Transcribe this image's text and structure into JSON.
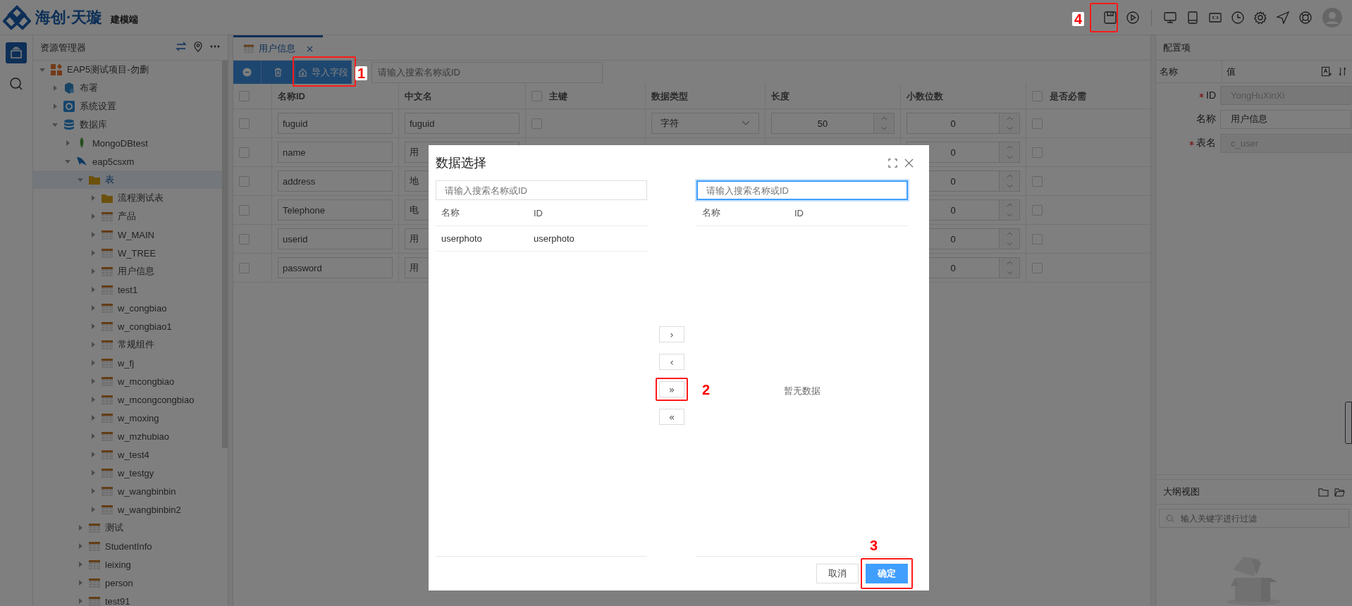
{
  "header": {
    "brand": "海创·天璇",
    "subtitle": "建模端",
    "tools_left": [
      {
        "kind": "save",
        "callout": "4"
      },
      {
        "kind": "play"
      }
    ],
    "tools_right": [
      {
        "kind": "desktop"
      },
      {
        "kind": "tablet"
      },
      {
        "kind": "ratio"
      },
      {
        "kind": "clock"
      },
      {
        "kind": "settings"
      },
      {
        "kind": "send"
      },
      {
        "kind": "help"
      },
      {
        "kind": "avatar"
      }
    ]
  },
  "activity_bar": [
    {
      "kind": "explorer",
      "selected": true
    },
    {
      "kind": "search",
      "selected": false
    }
  ],
  "explorer": {
    "title": "资源管理器",
    "actions": [
      {
        "kind": "swap"
      },
      {
        "kind": "locate"
      },
      {
        "kind": "more"
      }
    ],
    "tree": [
      {
        "kind": "project",
        "label": "EAP5测试项目-勿删",
        "expanded": true,
        "selected": false,
        "children": [
          {
            "kind": "deploy",
            "label": "布署",
            "expanded": false,
            "selected": false
          },
          {
            "kind": "settings",
            "label": "系统设置",
            "expanded": false,
            "selected": false
          },
          {
            "kind": "database",
            "label": "数据库",
            "expanded": true,
            "selected": false,
            "children": [
              {
                "kind": "mongo",
                "label": "MongoDBtest",
                "expanded": false,
                "selected": false
              },
              {
                "kind": "mysql",
                "label": "eap5csxm",
                "expanded": true,
                "selected": false,
                "children": [
                  {
                    "kind": "folder",
                    "label": "表",
                    "expanded": true,
                    "selected": true,
                    "children": [
                      {
                        "kind": "folder",
                        "label": "流程测试表",
                        "expanded": false,
                        "selected": false
                      },
                      {
                        "kind": "table",
                        "label": "产品",
                        "expanded": false,
                        "selected": false
                      },
                      {
                        "kind": "table",
                        "label": "W_MAIN",
                        "expanded": false,
                        "selected": false
                      },
                      {
                        "kind": "table",
                        "label": "W_TREE",
                        "expanded": false,
                        "selected": false
                      },
                      {
                        "kind": "table",
                        "label": "用户信息",
                        "expanded": false,
                        "selected": false
                      },
                      {
                        "kind": "table",
                        "label": "test1",
                        "expanded": false,
                        "selected": false
                      },
                      {
                        "kind": "table",
                        "label": "w_congbiao",
                        "expanded": false,
                        "selected": false
                      },
                      {
                        "kind": "table",
                        "label": "w_congbiao1",
                        "expanded": false,
                        "selected": false
                      },
                      {
                        "kind": "table",
                        "label": "常规组件",
                        "expanded": false,
                        "selected": false
                      },
                      {
                        "kind": "table",
                        "label": "w_fj",
                        "expanded": false,
                        "selected": false
                      },
                      {
                        "kind": "table",
                        "label": "w_mcongbiao",
                        "expanded": false,
                        "selected": false
                      },
                      {
                        "kind": "table",
                        "label": "w_mcongcongbiao",
                        "expanded": false,
                        "selected": false
                      },
                      {
                        "kind": "table",
                        "label": "w_moxing",
                        "expanded": false,
                        "selected": false
                      },
                      {
                        "kind": "table",
                        "label": "w_mzhubiao",
                        "expanded": false,
                        "selected": false
                      },
                      {
                        "kind": "table",
                        "label": "w_test4",
                        "expanded": false,
                        "selected": false
                      },
                      {
                        "kind": "table",
                        "label": "w_testgy",
                        "expanded": false,
                        "selected": false
                      },
                      {
                        "kind": "table",
                        "label": "w_wangbinbin",
                        "expanded": false,
                        "selected": false
                      },
                      {
                        "kind": "table",
                        "label": "w_wangbinbin2",
                        "expanded": false,
                        "selected": false
                      }
                    ]
                  },
                  {
                    "kind": "table",
                    "label": "测试",
                    "expanded": false,
                    "selected": false
                  },
                  {
                    "kind": "table",
                    "label": "StudentInfo",
                    "expanded": false,
                    "selected": false
                  },
                  {
                    "kind": "table",
                    "label": "leixing",
                    "expanded": false,
                    "selected": false
                  },
                  {
                    "kind": "table",
                    "label": "person",
                    "expanded": false,
                    "selected": false
                  },
                  {
                    "kind": "table",
                    "label": "test91",
                    "expanded": false,
                    "selected": false
                  }
                ]
              }
            ]
          }
        ]
      }
    ]
  },
  "editor": {
    "tabs": [
      {
        "label": "用户信息",
        "selected": true
      }
    ],
    "toolbar": {
      "buttons": [
        {
          "kind": "add"
        },
        {
          "kind": "delete"
        },
        {
          "kind": "import",
          "label": "导入字段",
          "callout": "1"
        }
      ],
      "search": {
        "placeholder": "请输入搜索名称或ID"
      }
    },
    "table": {
      "columns": [
        {
          "kind": "select",
          "checked": false
        },
        {
          "kind": "text",
          "label": "名称ID"
        },
        {
          "kind": "text",
          "label": "中文名"
        },
        {
          "kind": "flag",
          "label": "主键",
          "checked": false
        },
        {
          "kind": "choice",
          "label": "数据类型"
        },
        {
          "kind": "number",
          "label": "长度"
        },
        {
          "kind": "number",
          "label": "小数位数"
        },
        {
          "kind": "flag",
          "label": "是否必需",
          "checked": false
        }
      ],
      "rows": [
        {
          "cells": [
            {
              "checked": false
            },
            {
              "value": "fuguid"
            },
            {
              "value": "fuguid"
            },
            {
              "checked": false
            },
            {
              "value": "字符"
            },
            {
              "value": "50"
            },
            {
              "value": "0"
            },
            {
              "checked": false
            }
          ]
        },
        {
          "cells": [
            {
              "checked": false
            },
            {
              "value": "name"
            },
            {
              "value": "用"
            },
            null,
            null,
            null,
            {
              "value": "0"
            },
            {
              "checked": false
            }
          ]
        },
        {
          "cells": [
            {
              "checked": false
            },
            {
              "value": "address"
            },
            {
              "value": "地"
            },
            null,
            null,
            null,
            {
              "value": "0"
            },
            {
              "checked": false
            }
          ]
        },
        {
          "cells": [
            {
              "checked": false
            },
            {
              "value": "Telephone"
            },
            {
              "value": "电"
            },
            null,
            null,
            null,
            {
              "value": "0"
            },
            {
              "checked": false
            }
          ]
        },
        {
          "cells": [
            {
              "checked": false
            },
            {
              "value": "userid"
            },
            {
              "value": "用"
            },
            null,
            null,
            null,
            {
              "value": "0"
            },
            {
              "checked": false
            }
          ]
        },
        {
          "cells": [
            {
              "checked": false
            },
            {
              "value": "password"
            },
            {
              "value": "用"
            },
            null,
            null,
            null,
            {
              "value": "0"
            },
            {
              "checked": false
            }
          ]
        }
      ]
    }
  },
  "properties": {
    "title": "配置项",
    "columns": [
      "名称",
      "值"
    ],
    "items": [
      {
        "label": "ID",
        "required": true,
        "value": "YongHuXinXi",
        "disabled": true
      },
      {
        "label": "名称",
        "required": false,
        "value": "用户信息",
        "disabled": false
      },
      {
        "label": "表名",
        "required": true,
        "value": "c_user",
        "disabled": true
      }
    ]
  },
  "outline": {
    "title": "大纲视图",
    "search": {
      "placeholder": "输入关键字进行过滤"
    }
  },
  "dialog": {
    "title": "数据选择",
    "source": {
      "placeholder": "请输入搜索名称或ID",
      "focused": false,
      "columns": [
        "名称",
        "ID"
      ],
      "rows": [
        {
          "name": "userphoto",
          "id": "userphoto"
        }
      ]
    },
    "transfer_buttons": [
      {
        "label": "›"
      },
      {
        "label": "‹"
      },
      {
        "label": "»",
        "callout": "2"
      },
      {
        "label": "«"
      }
    ],
    "target": {
      "placeholder": "请输入搜索名称或ID",
      "focused": true,
      "columns": [
        "名称",
        "ID"
      ],
      "empty_text": "暂无数据"
    },
    "buttons": [
      {
        "kind": "cancel",
        "label": "取消"
      },
      {
        "kind": "confirm",
        "label": "确定",
        "callout": "3"
      }
    ]
  }
}
